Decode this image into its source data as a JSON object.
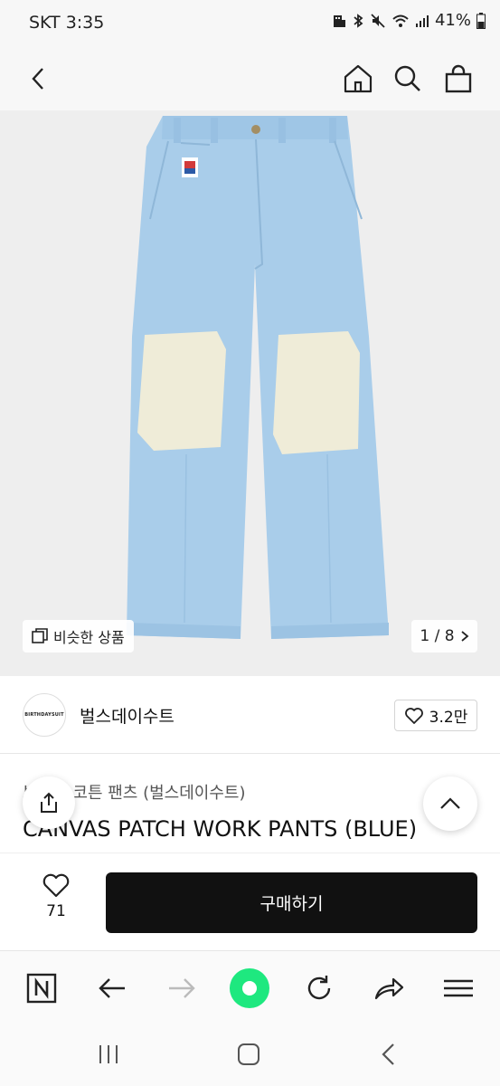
{
  "status": {
    "carrier_time": "SKT 3:35",
    "battery": "41%"
  },
  "gallery": {
    "similar_label": "비슷한 상품",
    "counter": "1 / 8"
  },
  "shop": {
    "avatar_text": "BIRTHDAYSUIT",
    "name": "벌스데이수트",
    "like_count": "3.2만"
  },
  "product": {
    "category": "브랜드 코튼 팬츠 (벌스데이수트)",
    "title": "CANVAS PATCH WORK PANTS (BLUE)"
  },
  "action": {
    "wish_count": "71",
    "buy_label": "구매하기"
  },
  "colors": {
    "pants": "#a9cdea",
    "patch": "#efecd8",
    "accent_green": "#1ee87f",
    "buy_bg": "#111111"
  },
  "icons": {
    "back": "back-arrow-icon",
    "home": "home-icon",
    "search": "search-icon",
    "bag": "shopping-bag-icon"
  }
}
